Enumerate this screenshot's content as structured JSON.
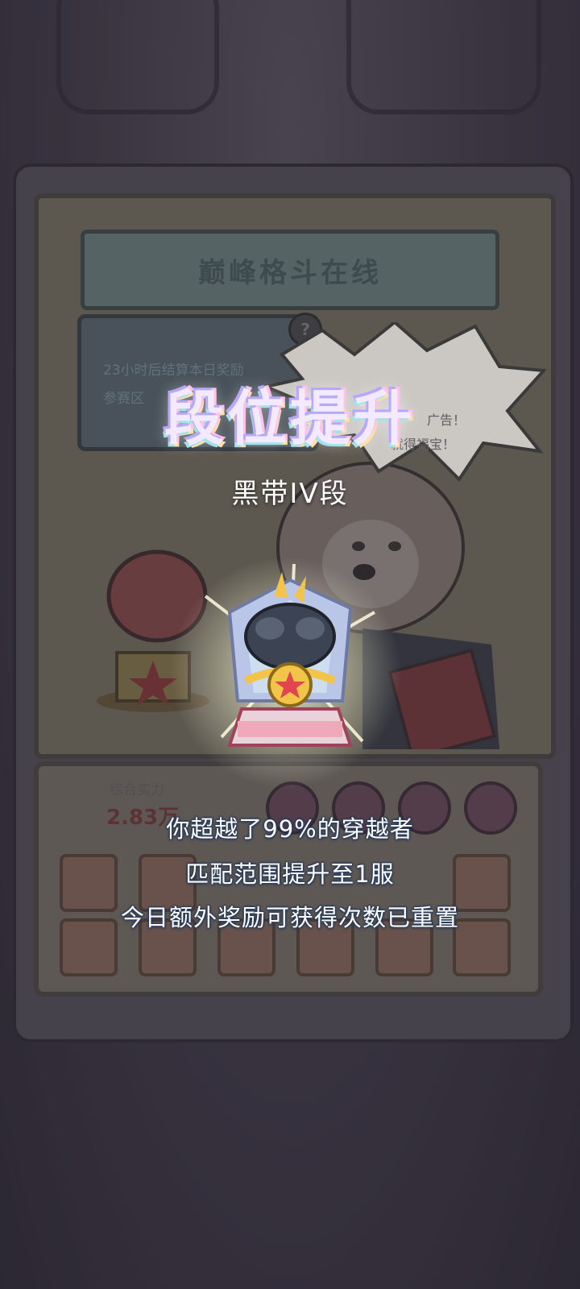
{
  "event": {
    "banner_title": "巅峰格斗在线",
    "info_line1": "23小时后结算本日奖励",
    "info_line2": "参赛区",
    "ad_line1": "广告！",
    "ad_line2": "就得福宝！"
  },
  "panel": {
    "power_label": "综合实力",
    "power_value": "2.83万"
  },
  "popup": {
    "title": "段位提升",
    "rank": "黑带IV段",
    "badge_icon": "black-belt-trophy-icon",
    "messages": [
      "你超越了99%的穿越者",
      "匹配范围提升至1服",
      "今日额外奖励可获得次数已重置"
    ]
  },
  "colors": {
    "title_fill": "#f3eaff",
    "text_outline": "#2a3d5a",
    "star_red": "#e04550"
  }
}
